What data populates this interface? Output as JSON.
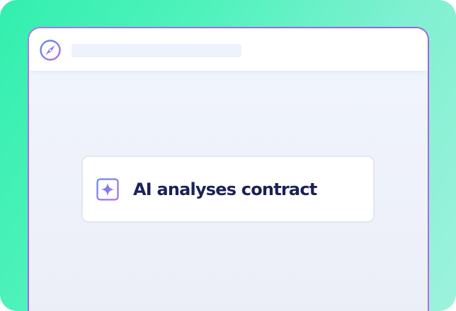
{
  "window": {
    "url_bar": "",
    "icon": "compass-icon"
  },
  "card": {
    "icon": "ai-sparkle-icon",
    "label": "AI analyses contract"
  },
  "colors": {
    "background_gradient_start": "#32efae",
    "background_gradient_end": "#9df2dd",
    "window_border": "#a86be0",
    "content_background": "#eff3fc",
    "card_text": "#1c2158",
    "accent_purple": "#9a62d8",
    "accent_blue": "#5b8cf0"
  }
}
